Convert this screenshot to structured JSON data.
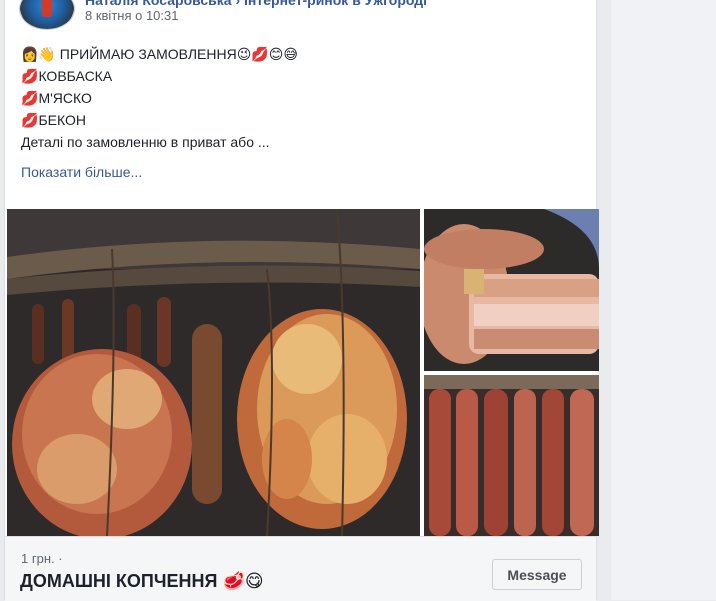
{
  "post": {
    "author": "Наталія Косаровська › Інтернет-ринок в Ужгороді",
    "timestamp": "8 квітня о 10:31",
    "lines": [
      {
        "emoji_before": "👩👋",
        "text": " ПРИЙМАЮ ЗАМОВЛЕННЯ",
        "emoji_after": "😉💋😊😅"
      },
      {
        "emoji_before": "💋",
        "text": "КОВБАСКА",
        "emoji_after": ""
      },
      {
        "emoji_before": "💋",
        "text": "М'ЯСКО",
        "emoji_after": ""
      },
      {
        "emoji_before": "💋",
        "text": "БЕКОН",
        "emoji_after": ""
      },
      {
        "emoji_before": "",
        "text": "Деталі по замовленню в приват або ...",
        "emoji_after": ""
      }
    ],
    "see_more": "Показати більше..."
  },
  "photos": [
    {
      "name": "photo-smoked-meat-hanging"
    },
    {
      "name": "photo-bacon-in-hand"
    },
    {
      "name": "photo-sausages"
    }
  ],
  "listing": {
    "price": "1 грн. ·",
    "title": "ДОМАШНІ КОПЧЕННЯ",
    "title_emoji": "🥩😋",
    "message_label": "Message"
  },
  "colors": {
    "link": "#385898",
    "background": "#e9ebee",
    "card": "#ffffff"
  }
}
